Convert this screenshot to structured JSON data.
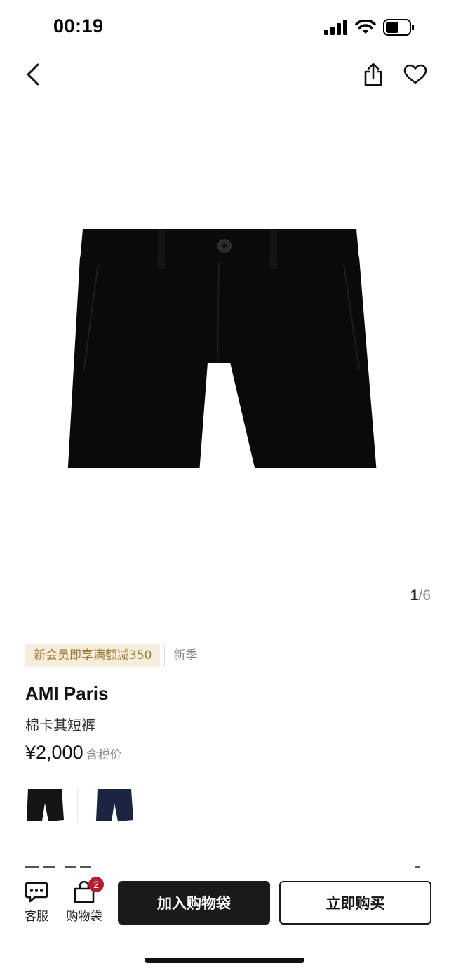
{
  "status_bar": {
    "time": "00:19"
  },
  "nav": {
    "icons": [
      "back-arrow-icon",
      "share-icon",
      "heart-icon"
    ]
  },
  "gallery": {
    "current_page": "1",
    "separator": "/",
    "total_pages": "6",
    "image": "black-shorts-product-photo"
  },
  "product": {
    "promo_tag": "新会员即享满额减350",
    "season_tag": "新季",
    "brand": "AMI Paris",
    "name": "棉卡其短裤",
    "price": "¥2,000",
    "tax_note": "含税价",
    "swatches": [
      {
        "color_name": "black",
        "color": "#141414"
      },
      {
        "color_name": "navy",
        "color": "#1b2440"
      }
    ]
  },
  "bottom_bar": {
    "service_label": "客服",
    "bag_label": "购物袋",
    "bag_count": "2",
    "add_to_bag_label": "加入购物袋",
    "buy_now_label": "立即购买"
  },
  "colors": {
    "promo_bg": "#f6eedc",
    "promo_text": "#9b7a33",
    "badge": "#b0212b",
    "primary_button": "#1a1a1a"
  }
}
